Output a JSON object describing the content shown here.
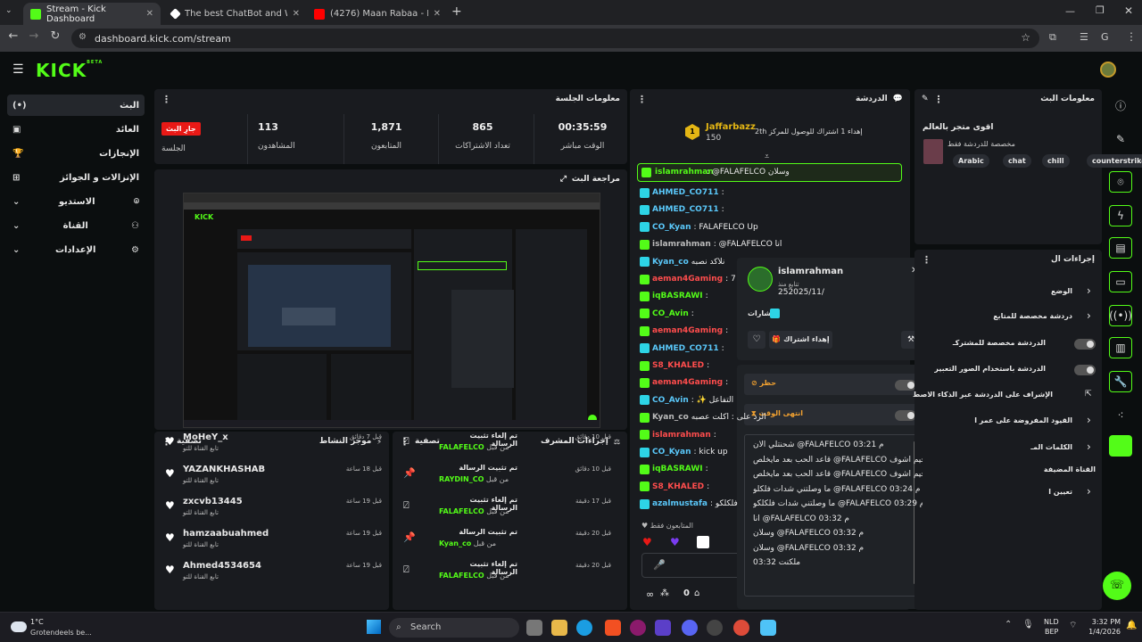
{
  "browser": {
    "tabs": [
      {
        "title": "Stream - Kick Dashboard",
        "active": true
      },
      {
        "title": "The best ChatBot and Widgets",
        "active": false
      },
      {
        "title": "(4276) Maan Rabaa - Mestelmi",
        "active": false
      }
    ],
    "url": "dashboard.kick.com/stream"
  },
  "app": {
    "logo": "KICK",
    "logo_tag": "BETA",
    "accent": "#53fc18"
  },
  "sidebar": {
    "items": [
      {
        "label": "البث",
        "icon": "broadcast-icon"
      },
      {
        "label": "العائد",
        "icon": "dollar-icon"
      },
      {
        "label": "الإنجازات",
        "icon": "trophy-icon"
      },
      {
        "label": "الإنزالات و الجوائز",
        "icon": "gift-icon"
      },
      {
        "label": "الاستديو",
        "icon": "studio-icon"
      },
      {
        "label": "القناة",
        "icon": "users-icon"
      },
      {
        "label": "الإعدادات",
        "icon": "gear-icon"
      }
    ]
  },
  "session": {
    "title": "معلومات الجلسة",
    "live_label": "جارِ البث",
    "session_label": "الجلسة",
    "stats": [
      {
        "value": "00:35:59",
        "label": "الوقت مباشر"
      },
      {
        "value": "865",
        "label": "تعداد الاشتراكات"
      },
      {
        "value": "1,871",
        "label": "المتابعون"
      },
      {
        "value": "113",
        "label": "المشاهدون"
      }
    ]
  },
  "preview": {
    "title": "مراجعة البث"
  },
  "activity": {
    "title": "موجز النشاط",
    "filter": "تصفية",
    "items": [
      {
        "user": "MoHeY_x",
        "desc": "تابع القناة للتو",
        "time": "قبل 7 دقائق"
      },
      {
        "user": "YAZANKHASHAB",
        "desc": "تابع القناة للتو",
        "time": "قبل 18 ساعة"
      },
      {
        "user": "zxcvb13445",
        "desc": "تابع القناة للتو",
        "time": "قبل 19 ساعة"
      },
      {
        "user": "hamzaabuahmed",
        "desc": "تابع القناة للتو",
        "time": "قبل 19 ساعة"
      },
      {
        "user": "Ahmed4534654",
        "desc": "تابع القناة للتو",
        "time": "قبل 19 ساعة"
      }
    ]
  },
  "modactions": {
    "title": "إجراءات المشرف",
    "filter": "تصفية",
    "items": [
      {
        "action": "تم إلغاء تثبيت الرسالة",
        "by": "من قبل",
        "mod": "FALAFELCO",
        "time": "قبل 10 دقائق"
      },
      {
        "action": "تم تثبيت الرسالة",
        "by": "من قبل",
        "mod": "RAYDIN_CO",
        "time": "قبل 10 دقائق"
      },
      {
        "action": "تم إلغاء تثبيت الرسالة",
        "by": "من قبل",
        "mod": "FALAFELCO",
        "time": "قبل 17 دقيقة"
      },
      {
        "action": "تم تثبيت الرسالة",
        "by": "من قبل",
        "mod": "Kyan_co",
        "time": "قبل 20 دقيقة"
      },
      {
        "action": "تم إلغاء تثبيت الرسالة",
        "by": "من قبل",
        "mod": "FALAFELCO",
        "time": "قبل 20 دقيقة"
      }
    ]
  },
  "chat": {
    "title": "الدردشة",
    "goal_user": "Jaffarbazz",
    "goal_amount": "150",
    "goal_rank": "1",
    "goal_text": "إهداء 1 اشتراك للوصول للمركز 2",
    "goal_suffix": "th",
    "pinned": {
      "user": "islamrahman",
      "text": ": @FALAFELCO وسلان"
    },
    "lines": [
      {
        "user": "AHMED_CO711",
        "text": ":",
        "color": "blue"
      },
      {
        "user": "AHMED_CO711",
        "text": ":",
        "color": "blue"
      },
      {
        "user": "CO_Kyan",
        "text": ": FALAFELCO Up",
        "color": "blue"
      },
      {
        "user": "islamrahman",
        "text": ": @FALAFELCO انا",
        "color": "gray",
        "prefix": "الرد على"
      },
      {
        "user": "Kyan_co",
        "text": "نلاكد نصبه",
        "color": "blue"
      },
      {
        "user": "aeman4Gaming",
        "text": ": 7",
        "color": "red"
      },
      {
        "user": "iqBASRAWI",
        "text": ":",
        "color": "green"
      },
      {
        "user": "CO_Avin",
        "text": ":",
        "color": "green"
      },
      {
        "user": "aeman4Gaming",
        "text": ":",
        "color": "red"
      },
      {
        "user": "AHMED_CO711",
        "text": ":",
        "color": "blue"
      },
      {
        "user": "S8_KHALED",
        "text": ":",
        "color": "red"
      },
      {
        "user": "aeman4Gaming",
        "text": ":",
        "color": "red"
      },
      {
        "user": "CO_Avin",
        "text": ": ✨ التفاعل",
        "color": "blue"
      },
      {
        "user": "Kyan_co",
        "text": "الرد على : اكلت عصبه",
        "color": "gray"
      },
      {
        "user": "islamrahman",
        "text": ":",
        "color": "red"
      },
      {
        "user": "CO_Kyan",
        "text": ": kick up",
        "color": "blue"
      },
      {
        "user": "iqBASRAWI",
        "text": ":",
        "color": "green"
      },
      {
        "user": "S8_KHALED",
        "text": ":",
        "color": "red"
      },
      {
        "user": "azalmustafa",
        "text": ": فلكلكو",
        "color": "blue"
      }
    ],
    "followers_only": "المتابعون فقط"
  },
  "userpopup": {
    "username": "islamrahman",
    "following_since_label": "تتابع منذ",
    "following_since": "252025/11/",
    "badges_label": "شارات",
    "gift_sub": "إهداء اشتراك",
    "ban_label": "حظر",
    "timeout_label": "انتهى الوقت",
    "messages": [
      "شحنتلي الان @FALAFELCO م 03:21",
      "قاعد الحب بعد مايخلص @FALAFELCO م 03:22 الجيم اشوف",
      "قاعد الحب بعد مايخلص @FALAFELCO م 03:23 الجيم اشوف",
      "ما وصلتني شدات فلكلو @FALAFELCO م 03:24",
      "ما وصلتني شدات فلكلكو @FALAFELCO م 03:29",
      "انا @FALAFELCO م 03:32",
      "وسلان @FALAFELCO م 03:32",
      "وسلان @FALAFELCO م 03:32",
      "ملكنت 03:32"
    ]
  },
  "streaminfo": {
    "title": "معلومات البث",
    "stream_title": "اقوى متجر بالعالم",
    "subtitle": "مخصصة للدردشة فقط",
    "tags": [
      "Arabic",
      "chat",
      "chill",
      "counterstrike"
    ]
  },
  "quickactions": {
    "title": "إجراءات ال",
    "items": [
      {
        "label": "الوضع",
        "control": "chevron"
      },
      {
        "label": "دردشة مخصصة للمتابع",
        "control": "chevron"
      },
      {
        "label": "الدردشة مخصصة للمشتركـ",
        "control": "toggle"
      },
      {
        "label": "الدردشة باستخدام الصور التعبير",
        "control": "toggle"
      },
      {
        "label": "الإشراف على الدردشة عبر الذكاء الاصط",
        "control": "external"
      },
      {
        "label": "القيود المفروضة على عمر ا",
        "control": "chevron"
      },
      {
        "label": "الكلمات المـ",
        "control": "chevron"
      },
      {
        "label": "القناة المضيفة",
        "control": "none"
      },
      {
        "label": "تعيين ا",
        "control": "chevron"
      }
    ]
  },
  "taskbar": {
    "weather_temp": "1°C",
    "weather_desc": "Grotendeels be...",
    "search": "Search",
    "lang1": "NLD",
    "lang2": "BEP",
    "time": "3:32 PM",
    "date": "1/4/2026"
  }
}
